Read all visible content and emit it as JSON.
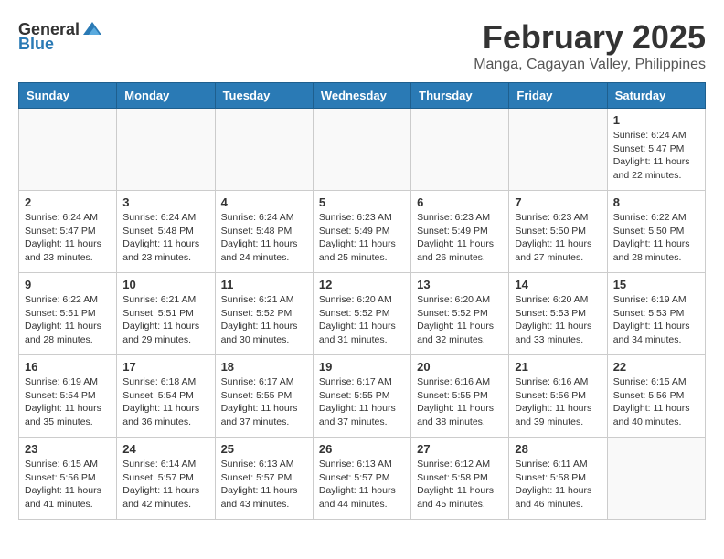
{
  "header": {
    "logo_general": "General",
    "logo_blue": "Blue",
    "title": "February 2025",
    "subtitle": "Manga, Cagayan Valley, Philippines"
  },
  "calendar": {
    "days_of_week": [
      "Sunday",
      "Monday",
      "Tuesday",
      "Wednesday",
      "Thursday",
      "Friday",
      "Saturday"
    ],
    "weeks": [
      [
        {
          "day": "",
          "info": ""
        },
        {
          "day": "",
          "info": ""
        },
        {
          "day": "",
          "info": ""
        },
        {
          "day": "",
          "info": ""
        },
        {
          "day": "",
          "info": ""
        },
        {
          "day": "",
          "info": ""
        },
        {
          "day": "1",
          "info": "Sunrise: 6:24 AM\nSunset: 5:47 PM\nDaylight: 11 hours\nand 22 minutes."
        }
      ],
      [
        {
          "day": "2",
          "info": "Sunrise: 6:24 AM\nSunset: 5:47 PM\nDaylight: 11 hours\nand 23 minutes."
        },
        {
          "day": "3",
          "info": "Sunrise: 6:24 AM\nSunset: 5:48 PM\nDaylight: 11 hours\nand 23 minutes."
        },
        {
          "day": "4",
          "info": "Sunrise: 6:24 AM\nSunset: 5:48 PM\nDaylight: 11 hours\nand 24 minutes."
        },
        {
          "day": "5",
          "info": "Sunrise: 6:23 AM\nSunset: 5:49 PM\nDaylight: 11 hours\nand 25 minutes."
        },
        {
          "day": "6",
          "info": "Sunrise: 6:23 AM\nSunset: 5:49 PM\nDaylight: 11 hours\nand 26 minutes."
        },
        {
          "day": "7",
          "info": "Sunrise: 6:23 AM\nSunset: 5:50 PM\nDaylight: 11 hours\nand 27 minutes."
        },
        {
          "day": "8",
          "info": "Sunrise: 6:22 AM\nSunset: 5:50 PM\nDaylight: 11 hours\nand 28 minutes."
        }
      ],
      [
        {
          "day": "9",
          "info": "Sunrise: 6:22 AM\nSunset: 5:51 PM\nDaylight: 11 hours\nand 28 minutes."
        },
        {
          "day": "10",
          "info": "Sunrise: 6:21 AM\nSunset: 5:51 PM\nDaylight: 11 hours\nand 29 minutes."
        },
        {
          "day": "11",
          "info": "Sunrise: 6:21 AM\nSunset: 5:52 PM\nDaylight: 11 hours\nand 30 minutes."
        },
        {
          "day": "12",
          "info": "Sunrise: 6:20 AM\nSunset: 5:52 PM\nDaylight: 11 hours\nand 31 minutes."
        },
        {
          "day": "13",
          "info": "Sunrise: 6:20 AM\nSunset: 5:52 PM\nDaylight: 11 hours\nand 32 minutes."
        },
        {
          "day": "14",
          "info": "Sunrise: 6:20 AM\nSunset: 5:53 PM\nDaylight: 11 hours\nand 33 minutes."
        },
        {
          "day": "15",
          "info": "Sunrise: 6:19 AM\nSunset: 5:53 PM\nDaylight: 11 hours\nand 34 minutes."
        }
      ],
      [
        {
          "day": "16",
          "info": "Sunrise: 6:19 AM\nSunset: 5:54 PM\nDaylight: 11 hours\nand 35 minutes."
        },
        {
          "day": "17",
          "info": "Sunrise: 6:18 AM\nSunset: 5:54 PM\nDaylight: 11 hours\nand 36 minutes."
        },
        {
          "day": "18",
          "info": "Sunrise: 6:17 AM\nSunset: 5:55 PM\nDaylight: 11 hours\nand 37 minutes."
        },
        {
          "day": "19",
          "info": "Sunrise: 6:17 AM\nSunset: 5:55 PM\nDaylight: 11 hours\nand 37 minutes."
        },
        {
          "day": "20",
          "info": "Sunrise: 6:16 AM\nSunset: 5:55 PM\nDaylight: 11 hours\nand 38 minutes."
        },
        {
          "day": "21",
          "info": "Sunrise: 6:16 AM\nSunset: 5:56 PM\nDaylight: 11 hours\nand 39 minutes."
        },
        {
          "day": "22",
          "info": "Sunrise: 6:15 AM\nSunset: 5:56 PM\nDaylight: 11 hours\nand 40 minutes."
        }
      ],
      [
        {
          "day": "23",
          "info": "Sunrise: 6:15 AM\nSunset: 5:56 PM\nDaylight: 11 hours\nand 41 minutes."
        },
        {
          "day": "24",
          "info": "Sunrise: 6:14 AM\nSunset: 5:57 PM\nDaylight: 11 hours\nand 42 minutes."
        },
        {
          "day": "25",
          "info": "Sunrise: 6:13 AM\nSunset: 5:57 PM\nDaylight: 11 hours\nand 43 minutes."
        },
        {
          "day": "26",
          "info": "Sunrise: 6:13 AM\nSunset: 5:57 PM\nDaylight: 11 hours\nand 44 minutes."
        },
        {
          "day": "27",
          "info": "Sunrise: 6:12 AM\nSunset: 5:58 PM\nDaylight: 11 hours\nand 45 minutes."
        },
        {
          "day": "28",
          "info": "Sunrise: 6:11 AM\nSunset: 5:58 PM\nDaylight: 11 hours\nand 46 minutes."
        },
        {
          "day": "",
          "info": ""
        }
      ]
    ]
  }
}
